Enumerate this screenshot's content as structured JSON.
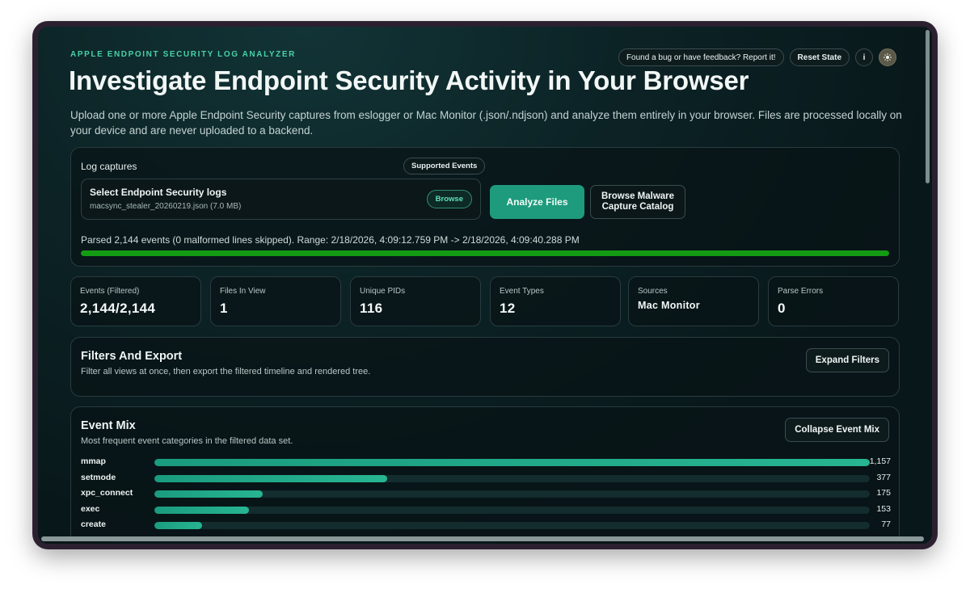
{
  "header": {
    "eyebrow": "APPLE ENDPOINT SECURITY LOG ANALYZER",
    "title": "Investigate Endpoint Security Activity in Your Browser",
    "description": "Upload one or more Apple Endpoint Security captures from eslogger or Mac Monitor (.json/.ndjson) and analyze them entirely in your browser. Files are processed locally on your device and are never uploaded to a backend.",
    "feedback_label": "Found a bug or have feedback? Report it!",
    "reset_label": "Reset State",
    "info_label": "i",
    "theme_icon": "sun-icon"
  },
  "upload": {
    "label": "Log captures",
    "supported_events_label": "Supported Events",
    "dropzone_title": "Select Endpoint Security logs",
    "file_name": "macsync_stealer_20260219.json (7.0 MB)",
    "browse_label": "Browse",
    "analyze_label": "Analyze Files",
    "catalog_label_line1": "Browse Malware",
    "catalog_label_line2": "Capture Catalog",
    "status": "Parsed 2,144 events (0 malformed lines skipped). Range: 2/18/2026, 4:09:12.759 PM -> 2/18/2026, 4:09:40.288 PM",
    "progress": 1.0,
    "progress_color": "#149b14"
  },
  "stats": [
    {
      "label": "Events (Filtered)",
      "value": "2,144/2,144"
    },
    {
      "label": "Files In View",
      "value": "1"
    },
    {
      "label": "Unique PIDs",
      "value": "116"
    },
    {
      "label": "Event Types",
      "value": "12"
    },
    {
      "label": "Sources",
      "value": "Mac Monitor"
    },
    {
      "label": "Parse Errors",
      "value": "0"
    }
  ],
  "filters": {
    "title": "Filters And Export",
    "subtitle": "Filter all views at once, then export the filtered timeline and rendered tree.",
    "expand_label": "Expand Filters"
  },
  "event_mix": {
    "title": "Event Mix",
    "subtitle": "Most frequent event categories in the filtered data set.",
    "collapse_label": "Collapse Event Mix",
    "accent": "#1e9b7d",
    "items": [
      {
        "name": "mmap",
        "count": 1157,
        "display": "1,157"
      },
      {
        "name": "setmode",
        "count": 377,
        "display": "377"
      },
      {
        "name": "xpc_connect",
        "count": 175,
        "display": "175"
      },
      {
        "name": "exec",
        "count": 153,
        "display": "153"
      },
      {
        "name": "create",
        "count": 77,
        "display": "77"
      }
    ]
  }
}
